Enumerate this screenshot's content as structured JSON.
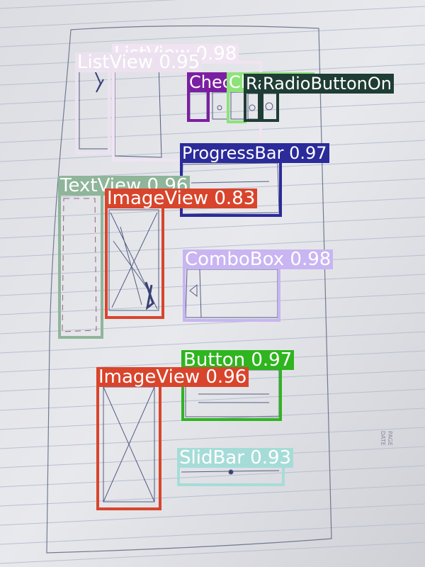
{
  "detections": [
    {
      "label": "ListView 0.98",
      "color": "#f0e4f2",
      "text_color": "#ffffff"
    },
    {
      "label": "ListView 0.95",
      "color": "#ece2ef",
      "text_color": "#ffffff"
    },
    {
      "label": "CheckBox",
      "color": "#7b1fa2",
      "text_color": "#ffffff"
    },
    {
      "label": "CheckBox",
      "color": "#8ee27a",
      "text_color": "#ffffff"
    },
    {
      "label": "RadioButtonOn 0",
      "color": "#1f3d34",
      "text_color": "#ffffff"
    },
    {
      "label": "RadioButtonOn",
      "color": "#1f3d34",
      "text_color": "#ffffff"
    },
    {
      "label": "ProgressBar 0.97",
      "color": "#2b2b9a",
      "text_color": "#ffffff"
    },
    {
      "label": "TextView 0.96",
      "color": "#8fb59a",
      "text_color": "#ffffff"
    },
    {
      "label": "ImageView 0.83",
      "color": "#d8452c",
      "text_color": "#ffffff"
    },
    {
      "label": "ComboBox 0.98",
      "color": "#c9b5f2",
      "text_color": "#ffffff"
    },
    {
      "label": "Button 0.97",
      "color": "#2fb51f",
      "text_color": "#ffffff"
    },
    {
      "label": "ImageView 0.96",
      "color": "#d8452c",
      "text_color": "#ffffff"
    },
    {
      "label": "SlidBar 0.93",
      "color": "#a6dcd8",
      "text_color": "#ffffff"
    }
  ],
  "paper_text": {
    "page": "PAGE",
    "date": "DATE"
  }
}
